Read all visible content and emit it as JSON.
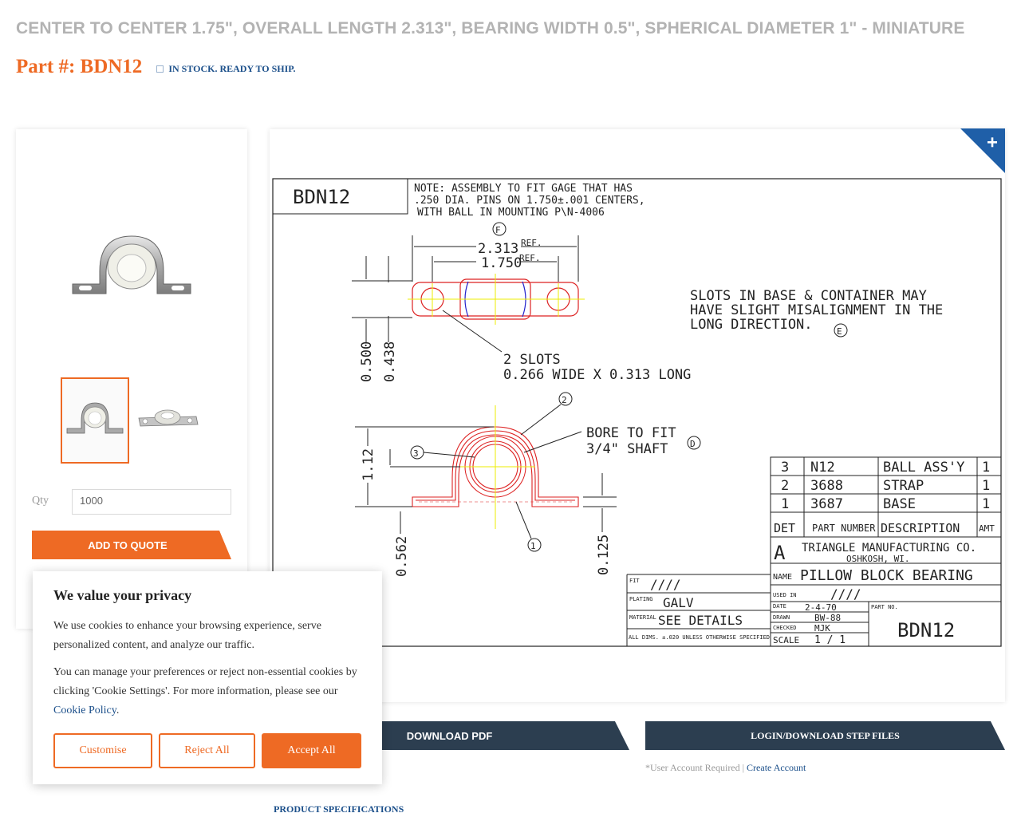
{
  "header": {
    "title": "CENTER TO CENTER 1.75\", OVERALL LENGTH 2.313\", BEARING WIDTH 0.5\", SPHERICAL DIAMETER 1\" - MINIATURE",
    "part_number": "Part #: BDN12",
    "stock_status": "IN STOCK. READY TO SHIP."
  },
  "product": {
    "main_image_icon": "pillow-block-bearing-photo",
    "thumbnails": [
      "pillow-block-front-view",
      "pillow-block-top-view"
    ],
    "qty_label": "Qty",
    "qty_value": "1000",
    "add_to_quote": "ADD TO QUOTE"
  },
  "drawing": {
    "expand_icon": "plus-icon",
    "part_id": "BDN12",
    "note_lines": [
      "NOTE: ASSEMBLY TO FIT GAGE THAT HAS",
      ".250 DIA. PINS ON 1.750±.001 CENTERS,",
      "WITH BALL IN MOUNTING    P\\N-4006"
    ],
    "dim_2313": "2.313",
    "dim_1750": "1.750",
    "ref": "REF.",
    "dim_0500": "0.500",
    "dim_0438": "0.438",
    "slots_line1": "2 SLOTS",
    "slots_line2": "0.266 WIDE X 0.313 LONG",
    "misalign_lines": [
      "SLOTS IN BASE & CONTAINER MAY",
      "HAVE SLIGHT MISALIGNMENT IN THE",
      "LONG DIRECTION."
    ],
    "bore_line1": "BORE TO FIT",
    "bore_line2": "3/4\" SHAFT",
    "dim_112": "1.12",
    "dim_0562": "0.562",
    "dim_0125": "0.125",
    "callouts": [
      "F",
      "E",
      "2",
      "3",
      "D",
      "1"
    ],
    "bom_rows": [
      [
        "3",
        "N12",
        "BALL ASS'Y",
        "1"
      ],
      [
        "2",
        "3688",
        "STRAP",
        "1"
      ],
      [
        "1",
        "3687",
        "BASE",
        "1"
      ]
    ],
    "bom_headers": [
      "DET",
      "PART NUMBER",
      "DESCRIPTION",
      "AMT"
    ],
    "company_mark": "A",
    "company": "TRIANGLE MANUFACTURING CO.",
    "city": "OSHKOSH, WI.",
    "name_label": "NAME",
    "name_value": "PILLOW BLOCK BEARING",
    "used_in_label": "USED IN",
    "used_in_value": "////",
    "fit_label": "FIT",
    "fit_value": "////",
    "plating_label": "PLATING",
    "plating_value": "GALV",
    "material_label": "MATERIAL",
    "material_value": "SEE DETAILS",
    "tolerance": "ALL DIMS. ±.020 UNLESS OTHERWISE SPECIFIED",
    "date_label": "DATE",
    "date_value": "2-4-70",
    "drawn_label": "DRAWN",
    "drawn_value": "BW-88",
    "checked_label": "CHECKED",
    "checked_value": "MJK",
    "scale_label": "SCALE",
    "scale_value": "1 / 1",
    "part_no_label": "PART NO.",
    "part_no_value": "BDN12"
  },
  "downloads": {
    "pdf": "DOWNLOAD PDF",
    "step": "LOGIN/DOWNLOAD STEP FILES",
    "account_note": "*User Account Required |",
    "create_account": "Create Account"
  },
  "specs_link": "PRODUCT SPECIFICATIONS",
  "cookie": {
    "title": "We value your privacy",
    "text1": "We use cookies to enhance your browsing experience, serve personalized content, and analyze our traffic.",
    "text2": "You can manage your preferences or reject non-essential cookies by clicking 'Cookie Settings'. For more information, please see our",
    "policy_link": "Cookie Policy",
    "customise": "Customise",
    "reject": "Reject All",
    "accept": "Accept All"
  },
  "colors": {
    "accent": "#ee6a24",
    "navy": "#2c3e50",
    "link": "#1b4f8a",
    "corner": "#1f5fa8"
  }
}
